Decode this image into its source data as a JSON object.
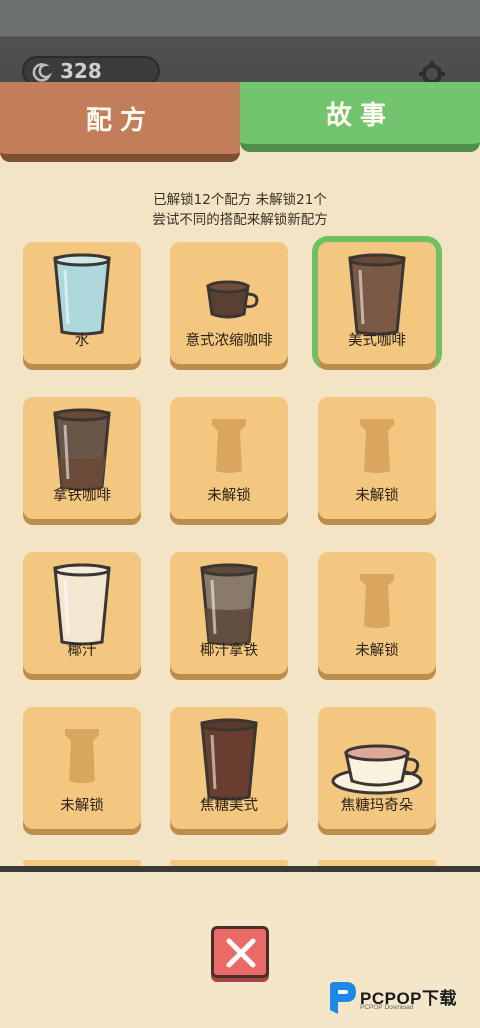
{
  "header": {
    "coins": "328"
  },
  "tabs": {
    "recipe": "配方",
    "story": "故事"
  },
  "info": {
    "line1": "已解锁12个配方 未解锁21个",
    "line2": "尝试不同的搭配来解锁新配方"
  },
  "recipes": [
    {
      "label": "水",
      "icon": "water-cup-icon"
    },
    {
      "label": "意式浓缩咖啡",
      "icon": "espresso-cup-icon"
    },
    {
      "label": "美式咖啡",
      "icon": "americano-cup-icon",
      "selected": true
    },
    {
      "label": "拿铁咖啡",
      "icon": "latte-cup-icon"
    },
    {
      "label": "未解锁",
      "icon": "locked-cup-icon"
    },
    {
      "label": "未解锁",
      "icon": "locked-cup-icon"
    },
    {
      "label": "椰汁",
      "icon": "coconut-milk-cup-icon"
    },
    {
      "label": "椰汁拿铁",
      "icon": "coconut-latte-cup-icon"
    },
    {
      "label": "未解锁",
      "icon": "locked-cup-icon"
    },
    {
      "label": "未解锁",
      "icon": "locked-cup-icon"
    },
    {
      "label": "焦糖美式",
      "icon": "caramel-americano-cup-icon"
    },
    {
      "label": "焦糖玛奇朵",
      "icon": "caramel-macchiato-cup-icon"
    }
  ],
  "watermark": {
    "brand": "PCPOP下载",
    "sub": "PCPOP Download"
  }
}
